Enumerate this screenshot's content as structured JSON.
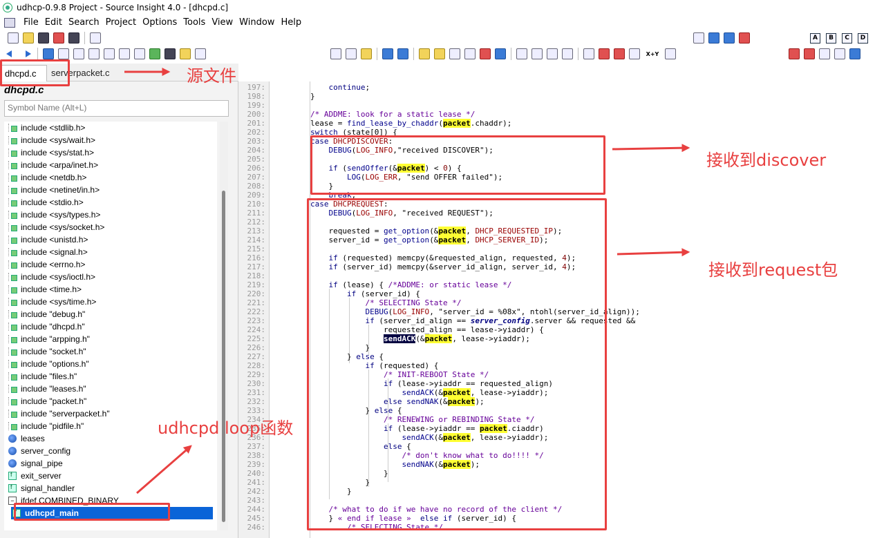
{
  "window": {
    "title": "udhcp-0.9.8 Project - Source Insight 4.0 - [dhcpd.c]"
  },
  "menu": [
    "File",
    "Edit",
    "Search",
    "Project",
    "Options",
    "Tools",
    "View",
    "Window",
    "Help"
  ],
  "toolbar": {
    "letters": [
      "A",
      "B",
      "C",
      "D"
    ],
    "xy_label": "X+Y"
  },
  "tabs": {
    "active": "dhcpd.c",
    "close_glyph": "×",
    "inactive": "serverpacket.c"
  },
  "left": {
    "file_title": "dhcpd.c",
    "search_placeholder": "Symbol Name (Alt+L)",
    "symbols": [
      {
        "label": "include <stdlib.h>",
        "icon": "include-icon"
      },
      {
        "label": "include <sys/wait.h>",
        "icon": "include-icon"
      },
      {
        "label": "include <sys/stat.h>",
        "icon": "include-icon"
      },
      {
        "label": "include <arpa/inet.h>",
        "icon": "include-icon"
      },
      {
        "label": "include <netdb.h>",
        "icon": "include-icon"
      },
      {
        "label": "include <netinet/in.h>",
        "icon": "include-icon"
      },
      {
        "label": "include <stdio.h>",
        "icon": "include-icon"
      },
      {
        "label": "include <sys/types.h>",
        "icon": "include-icon"
      },
      {
        "label": "include <sys/socket.h>",
        "icon": "include-icon"
      },
      {
        "label": "include <unistd.h>",
        "icon": "include-icon"
      },
      {
        "label": "include <signal.h>",
        "icon": "include-icon"
      },
      {
        "label": "include <errno.h>",
        "icon": "include-icon"
      },
      {
        "label": "include <sys/ioctl.h>",
        "icon": "include-icon"
      },
      {
        "label": "include <time.h>",
        "icon": "include-icon"
      },
      {
        "label": "include <sys/time.h>",
        "icon": "include-icon"
      },
      {
        "label": "include \"debug.h\"",
        "icon": "include-icon"
      },
      {
        "label": "include \"dhcpd.h\"",
        "icon": "include-icon"
      },
      {
        "label": "include \"arpping.h\"",
        "icon": "include-icon"
      },
      {
        "label": "include \"socket.h\"",
        "icon": "include-icon"
      },
      {
        "label": "include \"options.h\"",
        "icon": "include-icon"
      },
      {
        "label": "include \"files.h\"",
        "icon": "include-icon"
      },
      {
        "label": "include \"leases.h\"",
        "icon": "include-icon"
      },
      {
        "label": "include \"packet.h\"",
        "icon": "include-icon"
      },
      {
        "label": "include \"serverpacket.h\"",
        "icon": "include-icon"
      },
      {
        "label": "include \"pidfile.h\"",
        "icon": "include-icon"
      },
      {
        "label": "leases",
        "icon": "variable-icon"
      },
      {
        "label": "server_config",
        "icon": "variable-icon"
      },
      {
        "label": "signal_pipe",
        "icon": "variable-icon"
      },
      {
        "label": "exit_server",
        "icon": "function-icon"
      },
      {
        "label": "signal_handler",
        "icon": "function-icon"
      },
      {
        "label": "ifdef COMBINED_BINARY",
        "icon": "expand-icon"
      },
      {
        "label": "udhcpd_main",
        "icon": "function-icon",
        "selected": true
      }
    ]
  },
  "line_numbers": [
    "197",
    "198",
    "199",
    "200",
    "201",
    "202",
    "203",
    "204",
    "205",
    "206",
    "207",
    "208",
    "209",
    "210",
    "211",
    "212",
    "213",
    "214",
    "215",
    "216",
    "217",
    "218",
    "219",
    "220",
    "221",
    "222",
    "223",
    "224",
    "225",
    "226",
    "227",
    "228",
    "229",
    "230",
    "231",
    "232",
    "233",
    "234",
    "235",
    "236",
    "237",
    "238",
    "239",
    "240",
    "241",
    "242",
    "243",
    "244",
    "245",
    "246"
  ],
  "code": [
    [
      {
        "t": "            "
      },
      {
        "t": "continue",
        "c": "kw"
      },
      {
        "t": ";"
      }
    ],
    [
      {
        "t": "        }"
      }
    ],
    [
      {
        "t": ""
      }
    ],
    [
      {
        "t": "        "
      },
      {
        "t": "/* ADDME: look for a static lease */",
        "c": "cm"
      }
    ],
    [
      {
        "t": "        lease = "
      },
      {
        "t": "find_lease_by_chaddr",
        "c": "fn"
      },
      {
        "t": "("
      },
      {
        "t": "packet",
        "c": "hl"
      },
      {
        "t": ".chaddr);"
      }
    ],
    [
      {
        "t": "        "
      },
      {
        "t": "switch",
        "c": "kw"
      },
      {
        "t": " (state[0]) {"
      }
    ],
    [
      {
        "t": "        "
      },
      {
        "t": "case",
        "c": "kw"
      },
      {
        "t": " "
      },
      {
        "t": "DHCPDISCOVER",
        "c": "mac"
      },
      {
        "t": ":"
      }
    ],
    [
      {
        "t": "            "
      },
      {
        "t": "DEBUG",
        "c": "fn"
      },
      {
        "t": "("
      },
      {
        "t": "LOG_INFO",
        "c": "mac"
      },
      {
        "t": ",\"received DISCOVER\");"
      }
    ],
    [
      {
        "t": ""
      }
    ],
    [
      {
        "t": "            "
      },
      {
        "t": "if",
        "c": "kw"
      },
      {
        "t": " ("
      },
      {
        "t": "sendOffer",
        "c": "fn"
      },
      {
        "t": "(&"
      },
      {
        "t": "packet",
        "c": "hl"
      },
      {
        "t": ") < "
      },
      {
        "t": "0",
        "c": "nm"
      },
      {
        "t": ") {"
      }
    ],
    [
      {
        "t": "                "
      },
      {
        "t": "LOG",
        "c": "fn"
      },
      {
        "t": "("
      },
      {
        "t": "LOG_ERR",
        "c": "mac"
      },
      {
        "t": ", \"send OFFER failed\");"
      }
    ],
    [
      {
        "t": "            }"
      }
    ],
    [
      {
        "t": "            "
      },
      {
        "t": "break",
        "c": "kw"
      },
      {
        "t": ";"
      }
    ],
    [
      {
        "t": "        "
      },
      {
        "t": "case",
        "c": "kw"
      },
      {
        "t": " "
      },
      {
        "t": "DHCPREQUEST",
        "c": "mac"
      },
      {
        "t": ":"
      }
    ],
    [
      {
        "t": "            "
      },
      {
        "t": "DEBUG",
        "c": "fn"
      },
      {
        "t": "("
      },
      {
        "t": "LOG_INFO",
        "c": "mac"
      },
      {
        "t": ", \"received REQUEST\");"
      }
    ],
    [
      {
        "t": ""
      }
    ],
    [
      {
        "t": "            requested = "
      },
      {
        "t": "get_option",
        "c": "fn"
      },
      {
        "t": "(&"
      },
      {
        "t": "packet",
        "c": "hl"
      },
      {
        "t": ", "
      },
      {
        "t": "DHCP_REQUESTED_IP",
        "c": "mac"
      },
      {
        "t": ");"
      }
    ],
    [
      {
        "t": "            server_id = "
      },
      {
        "t": "get_option",
        "c": "fn"
      },
      {
        "t": "(&"
      },
      {
        "t": "packet",
        "c": "hl"
      },
      {
        "t": ", "
      },
      {
        "t": "DHCP_SERVER_ID",
        "c": "mac"
      },
      {
        "t": ");"
      }
    ],
    [
      {
        "t": ""
      }
    ],
    [
      {
        "t": "            "
      },
      {
        "t": "if",
        "c": "kw"
      },
      {
        "t": " (requested) memcpy(&requested_align, requested, "
      },
      {
        "t": "4",
        "c": "nm"
      },
      {
        "t": ");"
      }
    ],
    [
      {
        "t": "            "
      },
      {
        "t": "if",
        "c": "kw"
      },
      {
        "t": " (server_id) memcpy(&server_id_align, server_id, "
      },
      {
        "t": "4",
        "c": "nm"
      },
      {
        "t": ");"
      }
    ],
    [
      {
        "t": ""
      }
    ],
    [
      {
        "t": "            "
      },
      {
        "t": "if",
        "c": "kw"
      },
      {
        "t": " (lease) { "
      },
      {
        "t": "/*ADDME: or static lease */",
        "c": "cm"
      }
    ],
    [
      {
        "t": "                "
      },
      {
        "t": "if",
        "c": "kw"
      },
      {
        "t": " (server_id) {"
      }
    ],
    [
      {
        "t": "                    "
      },
      {
        "t": "/* SELECTING State */",
        "c": "cm"
      }
    ],
    [
      {
        "t": "                    "
      },
      {
        "t": "DEBUG",
        "c": "fn"
      },
      {
        "t": "("
      },
      {
        "t": "LOG_INFO",
        "c": "mac"
      },
      {
        "t": ", \"server_id = %08x\", ntohl(server_id_align));"
      }
    ],
    [
      {
        "t": "                    "
      },
      {
        "t": "if",
        "c": "kw"
      },
      {
        "t": " (server_id_align == "
      },
      {
        "t": "server_config",
        "c": "it"
      },
      {
        "t": ".server && requested &&"
      }
    ],
    [
      {
        "t": "                        requested_align == lease->yiaddr) {"
      }
    ],
    [
      {
        "t": "                        "
      },
      {
        "t": "sendACK",
        "c": "sa"
      },
      {
        "t": "(&"
      },
      {
        "t": "packet",
        "c": "hl"
      },
      {
        "t": ", lease->yiaddr);"
      }
    ],
    [
      {
        "t": "                    }"
      }
    ],
    [
      {
        "t": "                } "
      },
      {
        "t": "else",
        "c": "kw"
      },
      {
        "t": " {"
      }
    ],
    [
      {
        "t": "                    "
      },
      {
        "t": "if",
        "c": "kw"
      },
      {
        "t": " (requested) {"
      }
    ],
    [
      {
        "t": "                        "
      },
      {
        "t": "/* INIT-REBOOT State */",
        "c": "cm"
      }
    ],
    [
      {
        "t": "                        "
      },
      {
        "t": "if",
        "c": "kw"
      },
      {
        "t": " (lease->yiaddr == requested_align)"
      }
    ],
    [
      {
        "t": "                            "
      },
      {
        "t": "sendACK",
        "c": "fn"
      },
      {
        "t": "(&"
      },
      {
        "t": "packet",
        "c": "hl"
      },
      {
        "t": ", lease->yiaddr);"
      }
    ],
    [
      {
        "t": "                        "
      },
      {
        "t": "else",
        "c": "kw"
      },
      {
        "t": " "
      },
      {
        "t": "sendNAK",
        "c": "fn"
      },
      {
        "t": "(&"
      },
      {
        "t": "packet",
        "c": "hl"
      },
      {
        "t": ");"
      }
    ],
    [
      {
        "t": "                    } "
      },
      {
        "t": "else",
        "c": "kw"
      },
      {
        "t": " {"
      }
    ],
    [
      {
        "t": "                        "
      },
      {
        "t": "/* RENEWING or REBINDING State */",
        "c": "cm"
      }
    ],
    [
      {
        "t": "                        "
      },
      {
        "t": "if",
        "c": "kw"
      },
      {
        "t": " (lease->yiaddr == "
      },
      {
        "t": "packet",
        "c": "hl"
      },
      {
        "t": ".ciaddr)"
      }
    ],
    [
      {
        "t": "                            "
      },
      {
        "t": "sendACK",
        "c": "fn"
      },
      {
        "t": "(&"
      },
      {
        "t": "packet",
        "c": "hl"
      },
      {
        "t": ", lease->yiaddr);"
      }
    ],
    [
      {
        "t": "                        "
      },
      {
        "t": "else",
        "c": "kw"
      },
      {
        "t": " {"
      }
    ],
    [
      {
        "t": "                            "
      },
      {
        "t": "/* don't know what to do!!!! */",
        "c": "cm"
      }
    ],
    [
      {
        "t": "                            "
      },
      {
        "t": "sendNAK",
        "c": "fn"
      },
      {
        "t": "(&"
      },
      {
        "t": "packet",
        "c": "hl"
      },
      {
        "t": ");"
      }
    ],
    [
      {
        "t": "                        }"
      }
    ],
    [
      {
        "t": "                    }"
      }
    ],
    [
      {
        "t": "                }"
      }
    ],
    [
      {
        "t": ""
      }
    ],
    [
      {
        "t": "            "
      },
      {
        "t": "/* what to do if we have no record of the client */",
        "c": "cm"
      }
    ],
    [
      {
        "t": "            } "
      },
      {
        "t": "« end if lease »",
        "c": "cm"
      },
      {
        "t": "  "
      },
      {
        "t": "else",
        "c": "kw"
      },
      {
        "t": " "
      },
      {
        "t": "if",
        "c": "kw"
      },
      {
        "t": " (server_id) {"
      }
    ],
    [
      {
        "t": "                "
      },
      {
        "t": "/* SELECTING State */",
        "c": "cm"
      }
    ]
  ],
  "annotations": {
    "source_file": "源文件",
    "recv_discover": "接收到discover",
    "recv_request": "接收到request包",
    "loop_func": "udhcpd loop函数"
  },
  "colors": {
    "annotation": "#e84040",
    "selection": "#0a64d8",
    "highlight": "#ffff33"
  }
}
